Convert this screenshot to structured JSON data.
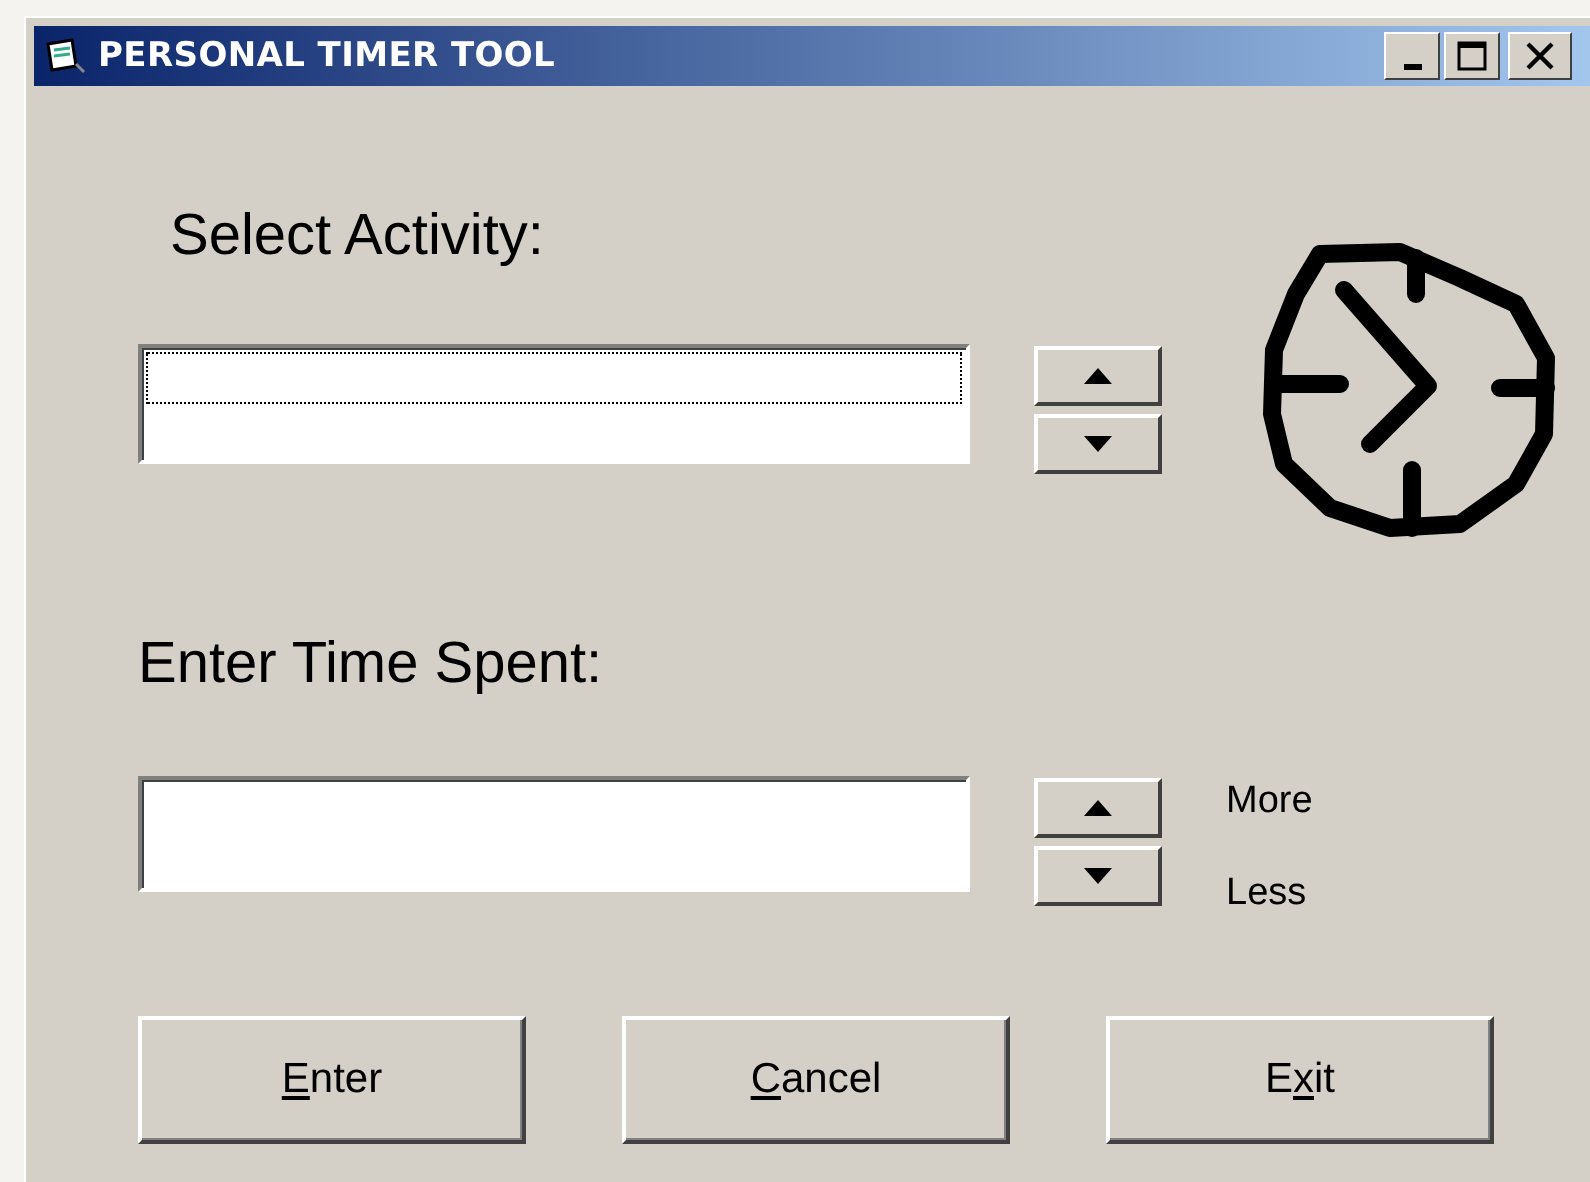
{
  "window": {
    "title": "PERSONAL TIMER TOOL",
    "controls": [
      {
        "kind": "minimize"
      },
      {
        "kind": "maximize"
      },
      {
        "kind": "close"
      }
    ]
  },
  "activity": {
    "label": "Select Activity:"
  },
  "time": {
    "label": "Enter Time Spent:",
    "up_label": "More",
    "down_label": "Less"
  },
  "buttons": [
    {
      "parts": [
        {
          "text": "E",
          "underline": true
        },
        {
          "text": "nter",
          "underline": false
        }
      ]
    },
    {
      "parts": [
        {
          "text": "C",
          "underline": true
        },
        {
          "text": "ancel",
          "underline": false
        }
      ]
    },
    {
      "parts": [
        {
          "text": "E",
          "underline": false
        },
        {
          "text": "x",
          "underline": true
        },
        {
          "text": "it",
          "underline": false
        }
      ]
    }
  ]
}
